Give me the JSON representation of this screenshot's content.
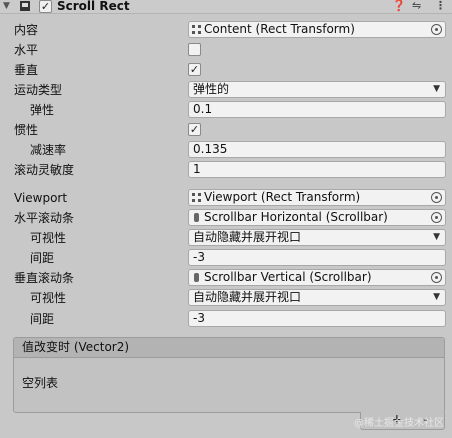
{
  "component": {
    "title": "Scroll Rect",
    "enabled_mark": "✓"
  },
  "fields": {
    "content": {
      "label": "内容",
      "value": "Content (Rect Transform)"
    },
    "horizontal": {
      "label": "水平",
      "checked": false,
      "mark": ""
    },
    "vertical": {
      "label": "垂直",
      "checked": true,
      "mark": "✓"
    },
    "movement_type": {
      "label": "运动类型",
      "value": "弹性的"
    },
    "elasticity": {
      "label": "弹性",
      "value": "0.1"
    },
    "inertia": {
      "label": "惯性",
      "checked": true,
      "mark": "✓"
    },
    "deceleration_rate": {
      "label": "减速率",
      "value": "0.135"
    },
    "scroll_sensitivity": {
      "label": "滚动灵敏度",
      "value": "1"
    },
    "viewport": {
      "label": "Viewport",
      "value": "Viewport (Rect Transform)"
    },
    "horizontal_scrollbar": {
      "label": "水平滚动条",
      "value": "Scrollbar Horizontal (Scrollbar)"
    },
    "h_visibility": {
      "label": "可视性",
      "value": "自动隐藏并展开视口"
    },
    "h_spacing": {
      "label": "间距",
      "value": "-3"
    },
    "vertical_scrollbar": {
      "label": "垂直滚动条",
      "value": "Scrollbar Vertical (Scrollbar)"
    },
    "v_visibility": {
      "label": "可视性",
      "value": "自动隐藏并展开视口"
    },
    "v_spacing": {
      "label": "间距",
      "value": "-3"
    }
  },
  "event": {
    "title": "值改变时 (Vector2)",
    "empty_text": "空列表",
    "add_label": "+",
    "remove_label": "-"
  },
  "watermark": "@稀土掘金技术社区",
  "icons": {
    "fold": "triangle-down-icon",
    "component": "scroll-rect-icon",
    "help": "help-icon",
    "preset": "preset-icon",
    "menu": "kebab-menu-icon"
  }
}
